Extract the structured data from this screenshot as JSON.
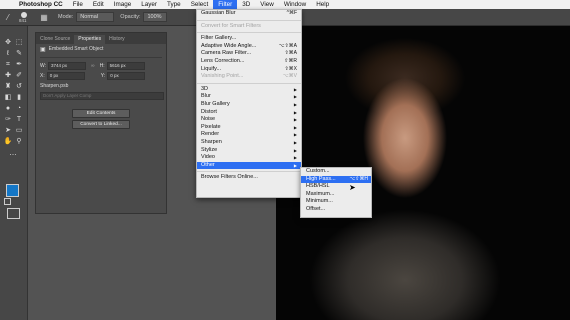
{
  "menubar": {
    "apple_icon": "apple-icon",
    "items": [
      "Photoshop CC",
      "File",
      "Edit",
      "Image",
      "Layer",
      "Type",
      "Select",
      "Filter",
      "3D",
      "View",
      "Window",
      "Help"
    ]
  },
  "options": {
    "brush_size": "841",
    "mode_label": "Mode:",
    "mode_value": "Normal",
    "opacity_label": "Opacity:",
    "opacity_value": "100%"
  },
  "panel": {
    "tabs": [
      "Clone Source",
      "Properties",
      "History"
    ],
    "title": "Embedded Smart Object",
    "w_label": "W:",
    "w_value": "3744 px",
    "h_label": "H:",
    "h_value": "5616 px",
    "x_label": "X:",
    "x_value": "0 px",
    "y_label": "Y:",
    "y_value": "0 px",
    "file_label": "Sharpen.psb",
    "comp_placeholder": "Don't Apply Layer Comp",
    "edit_button": "Edit Contents",
    "convert_button": "Convert to Linked..."
  },
  "filter_menu": {
    "last_filter": "Gaussian Blur",
    "last_filter_shortcut": "^⌘F",
    "convert_smart": "Convert for Smart Filters",
    "gallery": "Filter Gallery...",
    "adaptive": "Adaptive Wide Angle...",
    "adaptive_shortcut": "⌥⇧⌘A",
    "camera_raw": "Camera Raw Filter...",
    "camera_raw_shortcut": "⇧⌘A",
    "lens": "Lens Correction...",
    "lens_shortcut": "⇧⌘R",
    "liquify": "Liquify...",
    "liquify_shortcut": "⇧⌘X",
    "vanishing": "Vanishing Point...",
    "vanishing_shortcut": "⌥⌘V",
    "groups": [
      "3D",
      "Blur",
      "Blur Gallery",
      "Distort",
      "Noise",
      "Pixelate",
      "Render",
      "Sharpen",
      "Stylize",
      "Video",
      "Other"
    ],
    "browse": "Browse Filters Online..."
  },
  "other_submenu": {
    "items": [
      "Custom...",
      "High Pass...",
      "HSB/HSL",
      "Maximum...",
      "Minimum...",
      "Offset..."
    ],
    "high_pass_shortcut": "⌥⇧⌘H"
  },
  "colors": {
    "accent": "#2d6ff2",
    "foreground_swatch": "#1477c7",
    "background_swatch": "#111111"
  }
}
